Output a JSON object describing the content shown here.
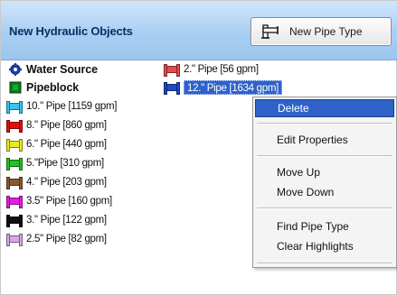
{
  "header": {
    "title": "New Hydraulic Objects",
    "new_pipe_button_label": "New Pipe Type"
  },
  "objects": {
    "left_column": [
      {
        "label": "Water Source",
        "icon": "gear-icon",
        "color": "#1a3fb0",
        "bold": true
      },
      {
        "label": "Pipeblock",
        "icon": "block-icon",
        "color": "#0a7a1e",
        "bold": true
      },
      {
        "label": "10.\" Pipe [1159 gpm]",
        "icon": "pipe-icon",
        "color": "#38c3ee"
      },
      {
        "label": "8.\" Pipe [860 gpm]",
        "icon": "pipe-icon",
        "color": "#e01010"
      },
      {
        "label": "6.\" Pipe [440 gpm]",
        "icon": "pipe-icon",
        "color": "#eaea22"
      },
      {
        "label": "5.\"Pipe [310 gpm]",
        "icon": "pipe-icon",
        "color": "#26c026"
      },
      {
        "label": "4.\" Pipe [203 gpm]",
        "icon": "pipe-icon",
        "color": "#8a5a34"
      },
      {
        "label": "3.5\" Pipe [160 gpm]",
        "icon": "pipe-icon",
        "color": "#e61ee0"
      },
      {
        "label": "3.\" Pipe [122 gpm]",
        "icon": "pipe-icon",
        "color": "#101010"
      },
      {
        "label": "2.5\" Pipe [82 gpm]",
        "icon": "pipe-icon",
        "color": "#d7a8e6"
      }
    ],
    "right_column": [
      {
        "label": "2.\" Pipe [56 gpm]",
        "icon": "pipe-icon",
        "color": "#e64a4a"
      },
      {
        "label": "12.\" Pipe [1634 gpm]",
        "icon": "pipe-icon",
        "color": "#1f49c9",
        "selected": true
      }
    ]
  },
  "context_menu": {
    "items": [
      "Delete",
      "Edit Properties",
      "Move Up",
      "Move Down",
      "Find Pipe Type",
      "Clear Highlights"
    ],
    "active_item": "Delete"
  },
  "colors": {
    "header_gradient_top": "#cfe6fb",
    "header_gradient_bottom": "#9cc5ee",
    "title_text": "#0b2d66",
    "selection": "#2f62c8"
  }
}
